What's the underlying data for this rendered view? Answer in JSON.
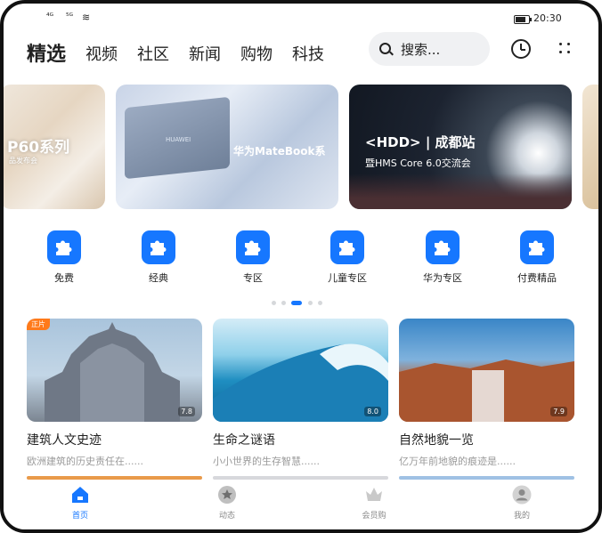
{
  "status_bar": {
    "signal_1": "⁴ᴳ",
    "signal_2": "⁵ᴳ",
    "time": "20:30"
  },
  "header": {
    "tabs": [
      {
        "label": "精选",
        "active": true
      },
      {
        "label": "视频",
        "active": false
      },
      {
        "label": "社区",
        "active": false
      },
      {
        "label": "新闻",
        "active": false
      },
      {
        "label": "购物",
        "active": false
      },
      {
        "label": "科技",
        "active": false
      }
    ],
    "search_placeholder": "搜索...",
    "history_icon": "clock-icon",
    "more_icon": "grid-dots-icon"
  },
  "banners": [
    {
      "title": "P60系列",
      "subtitle": "品发布会"
    },
    {
      "title": "华为MateBook系",
      "logo": "HUAWEI"
    },
    {
      "title": "<HDD> | 成都站",
      "subtitle": "暨HMS Core 6.0交流会"
    }
  ],
  "categories": [
    {
      "label": "免费",
      "icon": "puzzle-icon"
    },
    {
      "label": "经典",
      "icon": "puzzle-icon"
    },
    {
      "label": "专区",
      "icon": "puzzle-icon"
    },
    {
      "label": "儿童专区",
      "icon": "puzzle-icon"
    },
    {
      "label": "华为专区",
      "icon": "puzzle-icon"
    },
    {
      "label": "付费精品",
      "icon": "puzzle-icon"
    }
  ],
  "pager": {
    "count": 6,
    "active_index": 2
  },
  "cards": [
    {
      "tag": "正片",
      "score": "7.8",
      "title": "建筑人文史迹",
      "subtitle": "欧洲建筑的历史责任在......"
    },
    {
      "tag": "",
      "score": "8.0",
      "title": "生命之谜语",
      "subtitle": "小小世界的生存智慧......"
    },
    {
      "tag": "",
      "score": "7.9",
      "title": "自然地貌一览",
      "subtitle": "亿万年前地貌的痕迹是......"
    }
  ],
  "bottom_nav": [
    {
      "label": "首页",
      "icon": "home-icon",
      "active": true
    },
    {
      "label": "动态",
      "icon": "star-circle-icon",
      "active": false
    },
    {
      "label": "会员购",
      "icon": "crown-icon",
      "active": false
    },
    {
      "label": "我的",
      "icon": "user-icon",
      "active": false
    }
  ],
  "colors": {
    "accent": "#1677ff",
    "text": "#222222",
    "muted": "#9a9a9a",
    "tag": "#ff7a1a"
  }
}
